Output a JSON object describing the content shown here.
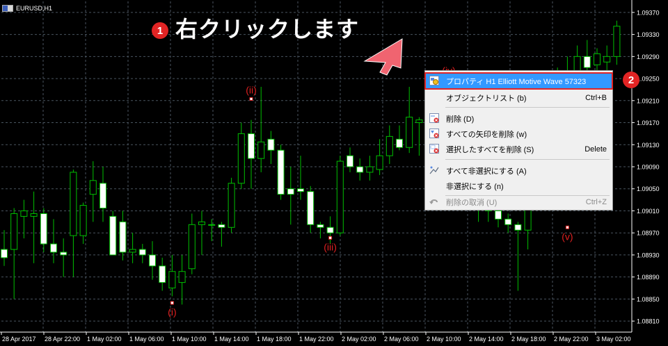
{
  "window": {
    "symbol_title": "EURUSD,H1"
  },
  "chart_data": {
    "type": "candlestick",
    "title": "EURUSD,H1",
    "y_ticks": [
      "1.09370",
      "1.09330",
      "1.09290",
      "1.09250",
      "1.09210",
      "1.09170",
      "1.09130",
      "1.09090",
      "1.09050",
      "1.09010",
      "1.08970",
      "1.08930",
      "1.08890",
      "1.08850",
      "1.08810"
    ],
    "x_ticks": [
      "28 Apr 2017",
      "28 Apr 22:00",
      "1 May 02:00",
      "1 May 06:00",
      "1 May 10:00",
      "1 May 14:00",
      "1 May 18:00",
      "1 May 22:00",
      "2 May 02:00",
      "2 May 06:00",
      "2 May 10:00",
      "2 May 14:00",
      "2 May 18:00",
      "2 May 22:00",
      "3 May 02:00"
    ],
    "ylim": [
      1.0879,
      1.0939
    ],
    "candles": [
      {
        "o": 1.0894,
        "h": 1.08975,
        "l": 1.0891,
        "c": 1.08925
      },
      {
        "o": 1.0894,
        "h": 1.09015,
        "l": 1.0885,
        "c": 1.09005
      },
      {
        "o": 1.09,
        "h": 1.0903,
        "l": 1.0896,
        "c": 1.0901
      },
      {
        "o": 1.09,
        "h": 1.09045,
        "l": 1.08915,
        "c": 1.09005
      },
      {
        "o": 1.09005,
        "h": 1.09015,
        "l": 1.08935,
        "c": 1.0895
      },
      {
        "o": 1.0895,
        "h": 1.08995,
        "l": 1.08915,
        "c": 1.08935
      },
      {
        "o": 1.08935,
        "h": 1.0896,
        "l": 1.0889,
        "c": 1.0893
      },
      {
        "o": 1.08965,
        "h": 1.09085,
        "l": 1.0889,
        "c": 1.0908
      },
      {
        "o": 1.08965,
        "h": 1.09025,
        "l": 1.0895,
        "c": 1.0902
      },
      {
        "o": 1.0904,
        "h": 1.091,
        "l": 1.0899,
        "c": 1.09065
      },
      {
        "o": 1.0906,
        "h": 1.0909,
        "l": 1.0899,
        "c": 1.09015
      },
      {
        "o": 1.09,
        "h": 1.0901,
        "l": 1.0894,
        "c": 1.0893
      },
      {
        "o": 1.0899,
        "h": 1.0901,
        "l": 1.0892,
        "c": 1.08935
      },
      {
        "o": 1.08935,
        "h": 1.0897,
        "l": 1.08915,
        "c": 1.0894
      },
      {
        "o": 1.0894,
        "h": 1.0895,
        "l": 1.08915,
        "c": 1.0893
      },
      {
        "o": 1.0893,
        "h": 1.08955,
        "l": 1.08885,
        "c": 1.0891
      },
      {
        "o": 1.0891,
        "h": 1.08925,
        "l": 1.08865,
        "c": 1.0888
      },
      {
        "o": 1.0887,
        "h": 1.0893,
        "l": 1.08855,
        "c": 1.089
      },
      {
        "o": 1.0888,
        "h": 1.0893,
        "l": 1.0884,
        "c": 1.089
      },
      {
        "o": 1.08905,
        "h": 1.09005,
        "l": 1.08895,
        "c": 1.08985
      },
      {
        "o": 1.08985,
        "h": 1.0901,
        "l": 1.0893,
        "c": 1.0899
      },
      {
        "o": 1.08985,
        "h": 1.08995,
        "l": 1.08955,
        "c": 1.08985
      },
      {
        "o": 1.08985,
        "h": 1.0899,
        "l": 1.08945,
        "c": 1.0898
      },
      {
        "o": 1.0898,
        "h": 1.0907,
        "l": 1.0897,
        "c": 1.0906
      },
      {
        "o": 1.0906,
        "h": 1.0917,
        "l": 1.0905,
        "c": 1.0915
      },
      {
        "o": 1.0915,
        "h": 1.09175,
        "l": 1.0905,
        "c": 1.09105
      },
      {
        "o": 1.09105,
        "h": 1.09235,
        "l": 1.0908,
        "c": 1.09135
      },
      {
        "o": 1.0914,
        "h": 1.09155,
        "l": 1.09095,
        "c": 1.0912
      },
      {
        "o": 1.0912,
        "h": 1.0913,
        "l": 1.0903,
        "c": 1.0904
      },
      {
        "o": 1.0905,
        "h": 1.0909,
        "l": 1.08985,
        "c": 1.0904
      },
      {
        "o": 1.0905,
        "h": 1.0911,
        "l": 1.0903,
        "c": 1.09045
      },
      {
        "o": 1.09045,
        "h": 1.09055,
        "l": 1.0897,
        "c": 1.08985
      },
      {
        "o": 1.08985,
        "h": 1.0899,
        "l": 1.0896,
        "c": 1.0898
      },
      {
        "o": 1.0898,
        "h": 1.09,
        "l": 1.0895,
        "c": 1.0897
      },
      {
        "o": 1.0897,
        "h": 1.0911,
        "l": 1.08965,
        "c": 1.091
      },
      {
        "o": 1.0911,
        "h": 1.09125,
        "l": 1.0908,
        "c": 1.0909
      },
      {
        "o": 1.0909,
        "h": 1.09105,
        "l": 1.09065,
        "c": 1.0908
      },
      {
        "o": 1.0908,
        "h": 1.0911,
        "l": 1.09065,
        "c": 1.0909
      },
      {
        "o": 1.09085,
        "h": 1.0914,
        "l": 1.09075,
        "c": 1.0911
      },
      {
        "o": 1.0911,
        "h": 1.09165,
        "l": 1.09095,
        "c": 1.09145
      },
      {
        "o": 1.0914,
        "h": 1.09165,
        "l": 1.0912,
        "c": 1.09125
      },
      {
        "o": 1.09125,
        "h": 1.09235,
        "l": 1.09115,
        "c": 1.0918
      },
      {
        "o": 1.0917,
        "h": 1.0918,
        "l": 1.0911,
        "c": 1.09175
      },
      {
        "o": 1.09175,
        "h": 1.09255,
        "l": 1.0916,
        "c": 1.09215
      },
      {
        "o": 1.09215,
        "h": 1.09245,
        "l": 1.0912,
        "c": 1.09135
      },
      {
        "o": 1.09135,
        "h": 1.09145,
        "l": 1.0909,
        "c": 1.0911
      },
      {
        "o": 1.0911,
        "h": 1.09125,
        "l": 1.0906,
        "c": 1.0908
      },
      {
        "o": 1.0908,
        "h": 1.09095,
        "l": 1.0902,
        "c": 1.0905
      },
      {
        "o": 1.0905,
        "h": 1.09065,
        "l": 1.0899,
        "c": 1.0903
      },
      {
        "o": 1.0903,
        "h": 1.0904,
        "l": 1.0899,
        "c": 1.0901
      },
      {
        "o": 1.0901,
        "h": 1.0902,
        "l": 1.0898,
        "c": 1.08995
      },
      {
        "o": 1.08995,
        "h": 1.09005,
        "l": 1.0897,
        "c": 1.08985
      },
      {
        "o": 1.08985,
        "h": 1.0899,
        "l": 1.08865,
        "c": 1.08975
      },
      {
        "o": 1.08975,
        "h": 1.0908,
        "l": 1.0894,
        "c": 1.0906
      },
      {
        "o": 1.0906,
        "h": 1.0916,
        "l": 1.0905,
        "c": 1.09155
      },
      {
        "o": 1.09155,
        "h": 1.0924,
        "l": 1.0914,
        "c": 1.0923
      },
      {
        "o": 1.0923,
        "h": 1.0927,
        "l": 1.092,
        "c": 1.0925
      },
      {
        "o": 1.0925,
        "h": 1.0929,
        "l": 1.0921,
        "c": 1.0926
      },
      {
        "o": 1.09255,
        "h": 1.0931,
        "l": 1.092,
        "c": 1.0929
      },
      {
        "o": 1.0929,
        "h": 1.0932,
        "l": 1.0923,
        "c": 1.0927
      },
      {
        "o": 1.09275,
        "h": 1.09305,
        "l": 1.0925,
        "c": 1.09295
      },
      {
        "o": 1.0928,
        "h": 1.0931,
        "l": 1.0924,
        "c": 1.0929
      },
      {
        "o": 1.0929,
        "h": 1.09355,
        "l": 1.09275,
        "c": 1.09345
      },
      {
        "o": 1.09345,
        "h": 1.0936,
        "l": 1.0931,
        "c": 1.0933
      },
      {
        "o": 1.0933,
        "h": 1.0937,
        "l": 1.0929,
        "c": 1.09335
      },
      {
        "o": 1.0933,
        "h": 1.09365,
        "l": 1.0932,
        "c": 1.0933
      }
    ],
    "wave_labels": [
      {
        "text": "(i)",
        "candle": 17,
        "price": 1.08843,
        "pos": "below"
      },
      {
        "text": "(ii)",
        "candle": 25,
        "price": 1.09213,
        "pos": "above"
      },
      {
        "text": "(iii)",
        "candle": 33,
        "price": 1.08961,
        "pos": "below"
      },
      {
        "text": "(iv)",
        "candle": 45,
        "price": 1.09248,
        "pos": "above"
      },
      {
        "text": "(v)",
        "candle": 57,
        "price": 1.0898,
        "pos": "below"
      }
    ],
    "colors": {
      "up_border": "#00c000",
      "down_body": "#ffffff",
      "wick": "#00c000",
      "grid": "#4a5560",
      "axis_text": "#ffffff",
      "wave": "#e02020"
    }
  },
  "annotation": {
    "step1_number": "1",
    "step1_text": "右クリックします",
    "step2_number": "2"
  },
  "context_menu": {
    "items": [
      {
        "label": "プロパティ H1 Elliott Motive Wave 57323",
        "shortcut": "",
        "icon": "properties-icon",
        "highlighted": true
      },
      {
        "label": "オブジェクトリスト (b)",
        "shortcut": "Ctrl+B",
        "icon": "",
        "highlighted": false
      },
      {
        "label": "削除 (D)",
        "shortcut": "",
        "icon": "delete-icon",
        "highlighted": false
      },
      {
        "label": "すべての矢印を削除 (w)",
        "shortcut": "",
        "icon": "delete-arrows-icon",
        "highlighted": false
      },
      {
        "label": "選択したすべてを削除 (S)",
        "shortcut": "Delete",
        "icon": "delete-selected-icon",
        "highlighted": false
      },
      {
        "label": "すべて非選択にする (A)",
        "shortcut": "",
        "icon": "unselect-icon",
        "highlighted": false
      },
      {
        "label": "非選択にする (n)",
        "shortcut": "",
        "icon": "",
        "highlighted": false
      },
      {
        "label": "削除の取消 (U)",
        "shortcut": "Ctrl+Z",
        "icon": "undo-icon",
        "highlighted": false,
        "disabled": true
      }
    ]
  }
}
